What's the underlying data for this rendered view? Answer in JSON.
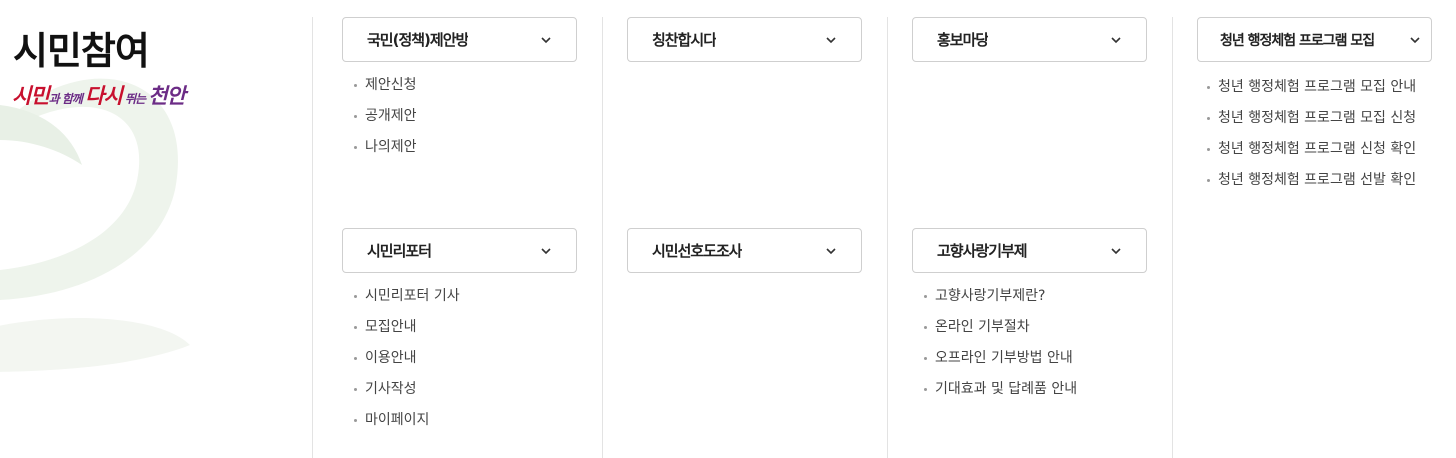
{
  "hero": {
    "title": "시민참여",
    "slogan": {
      "part1": "시민",
      "part2": "과 함께 ",
      "part3": "다시",
      "part4": " 뛰는 ",
      "part5": "천안"
    }
  },
  "menus": [
    {
      "label": "국민(정책)제안방",
      "items": [
        "제안신청",
        "공개제안",
        "나의제안"
      ]
    },
    {
      "label": "칭찬합시다",
      "items": []
    },
    {
      "label": "홍보마당",
      "items": []
    },
    {
      "label": "청년 행정체험 프로그램 모집",
      "items": [
        "청년 행정체험 프로그램 모집 안내",
        "청년 행정체험 프로그램 모집 신청",
        "청년 행정체험 프로그램 신청 확인",
        "청년 행정체험 프로그램 선발 확인"
      ]
    },
    {
      "label": "시민리포터",
      "items": [
        "시민리포터 기사",
        "모집안내",
        "이용안내",
        "기사작성",
        "마이페이지"
      ]
    },
    {
      "label": "시민선호도조사",
      "items": []
    },
    {
      "label": "고향사랑기부제",
      "items": [
        "고향사랑기부제란?",
        "온라인 기부절차",
        "오프라인 기부방법 안내",
        "기대효과 및 답례품 안내"
      ]
    }
  ],
  "icons": {
    "menu_toggle": "chevron-down-icon"
  },
  "colors": {
    "slogan_red": "#c8102e",
    "slogan_purple": "#6c2c86",
    "border": "#cfcfcf"
  }
}
